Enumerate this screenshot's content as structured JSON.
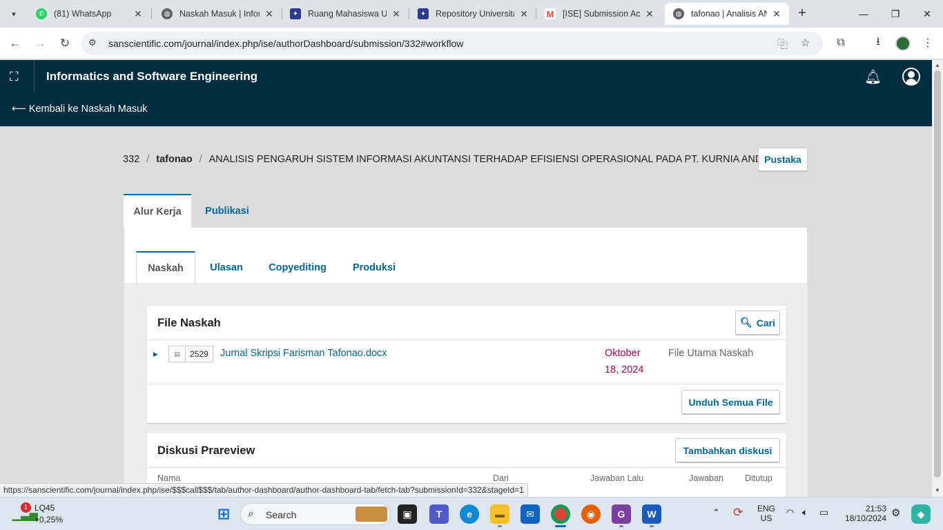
{
  "browser": {
    "tabs": [
      {
        "title": "(81) WhatsApp",
        "favicon_color": "#25d366"
      },
      {
        "title": "Naskah Masuk | Infor",
        "favicon_color": "#5f6368"
      },
      {
        "title": "Ruang Mahasiswa Un",
        "favicon_color": "#2b3a8c"
      },
      {
        "title": "Repository Universita",
        "favicon_color": "#2b3a8c"
      },
      {
        "title": "[ISE] Submission Ack",
        "favicon_color": "#ea4335"
      },
      {
        "title": "tafonao | Analisis AN",
        "favicon_color": "#5f6368"
      }
    ],
    "url": "sanscientific.com/journal/index.php/ise/authorDashboard/submission/332#workflow",
    "status_url": "https://sanscientific.com/journal/index.php/ise/$$$call$$$/tab/author-dashboard/author-dashboard-tab/fetch-tab?submissionId=332&stageId=1"
  },
  "header": {
    "journal_title": "Informatics and Software Engineering",
    "back_link": "⟵ Kembali ke Naskah Masuk"
  },
  "submission": {
    "id": "332",
    "author": "tafonao",
    "title": "ANALISIS PENGARUH SISTEM INFORMASI AKUNTANSI TERHADAP EFISIENSI OPERASIONAL PADA PT. KURNIA ANDALA",
    "library_button": "Pustaka"
  },
  "main_tabs": [
    "Alur Kerja",
    "Publikasi"
  ],
  "stage_tabs": [
    "Naskah",
    "Ulasan",
    "Copyediting",
    "Produksi"
  ],
  "files_card": {
    "title": "File Naskah",
    "search_button": "Cari",
    "file": {
      "id": "2529",
      "name": "Jurnal Skripsi Farisman Tafonao.docx",
      "date_line1": "Oktober",
      "date_line2": "18, 2024",
      "type": "File Utama Naskah"
    },
    "download_all": "Unduh Semua File"
  },
  "discussion_card": {
    "title": "Diskusi Prareview",
    "add_button": "Tambahkan diskusi",
    "columns": [
      "Nama",
      "Dari",
      "Jawaban Lalu",
      "Jawaban",
      "Ditutup"
    ]
  },
  "taskbar": {
    "stock_name": "LQ45",
    "stock_change": "+0,25%",
    "stock_badge": "1",
    "search_label": "Search",
    "lang_line1": "ENG",
    "lang_line2": "US",
    "time": "21:53",
    "date": "18/10/2024"
  },
  "colors": {
    "ojs_header": "#002c40",
    "link_blue": "#006798",
    "date_red": "#b1004f"
  }
}
